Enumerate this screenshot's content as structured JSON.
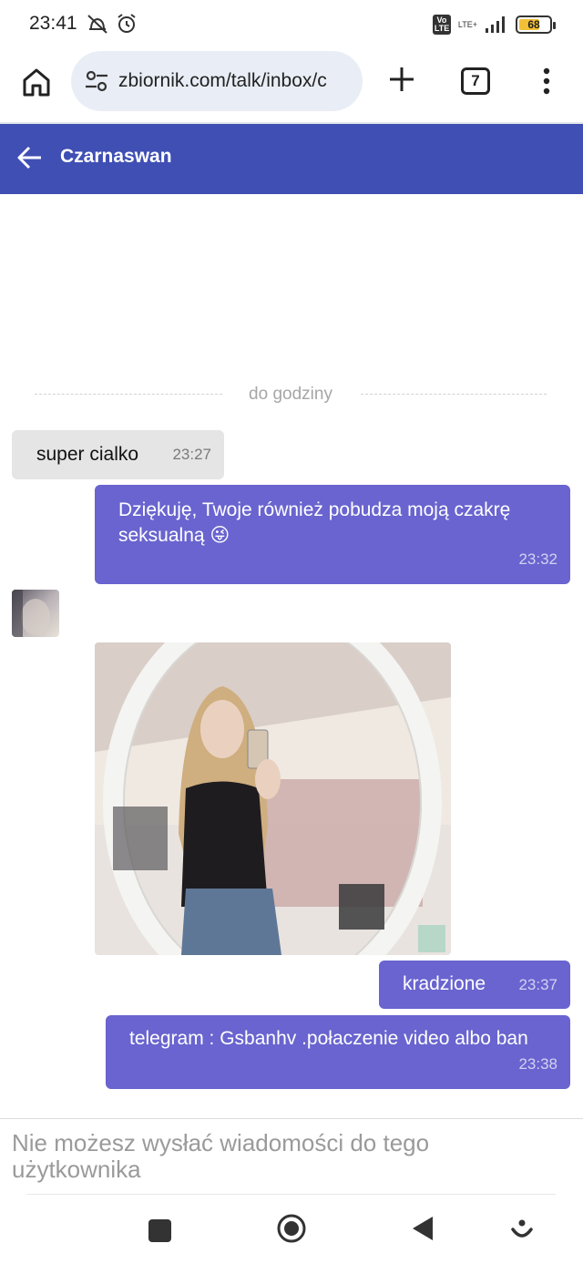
{
  "status_bar": {
    "time": "23:41",
    "network_badge": "Vo LTE",
    "network_type": "LTE+",
    "battery_level": "68"
  },
  "browser": {
    "url": "zbiornik.com/talk/inbox/c",
    "tab_count": "7"
  },
  "header": {
    "title": "Czarnaswan"
  },
  "chat": {
    "date_separator": "do godziny",
    "messages": [
      {
        "direction": "in",
        "text": "super cialko",
        "time": "23:27"
      },
      {
        "direction": "out",
        "text": "Dziękuję, Twoje również pobudza moją czakrę seksualną 😜",
        "time": "23:32"
      },
      {
        "direction": "in",
        "type": "image"
      },
      {
        "direction": "out",
        "text": "kradzione",
        "time": "23:37"
      },
      {
        "direction": "out",
        "text": "telegram : Gsbanhv .połaczenie video albo ban",
        "time": "23:38"
      }
    ]
  },
  "footer": {
    "notice": "Nie możesz wysłać wiadomości do tego użytkownika"
  },
  "colors": {
    "header_bg": "#3f4fb4",
    "outgoing_bubble": "#6964cf",
    "incoming_bubble": "#e5e5e5"
  },
  "icons": [
    "home-icon",
    "site-settings-icon",
    "plus-icon",
    "tabs-icon",
    "more-vert-icon",
    "back-arrow-icon",
    "nav-recents-icon",
    "nav-home-icon",
    "nav-back-icon",
    "nav-assistant-icon"
  ]
}
